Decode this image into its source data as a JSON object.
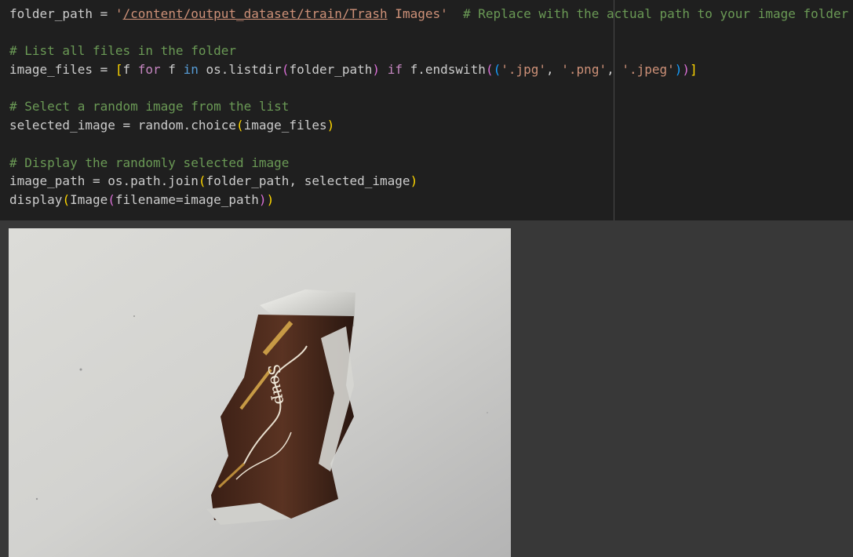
{
  "code": {
    "l1": {
      "var": "folder_path",
      "eq": " = ",
      "q_open": "'",
      "path_link": "/content/output_dataset/train/Trash",
      "path_rest": " Images",
      "q_close": "'",
      "comment": "  # Replace with the actual path to your image folder"
    },
    "l2": {
      "comment": "# List all files in the folder"
    },
    "l3": {
      "a": "image_files = ",
      "br_open": "[",
      "f1": "f ",
      "for_kw": "for",
      "f2": " f ",
      "in_kw": "in",
      "call": " os.listdir",
      "p_open": "(",
      "arg": "folder_path",
      "p_close": ")",
      "sp1": " ",
      "if_kw": "if",
      "method": " f.endswith",
      "pp_open": "(",
      "t_open": "(",
      "ext1": "'.jpg'",
      "c1": ", ",
      "ext2": "'.png'",
      "c2": ", ",
      "ext3": "'.jpeg'",
      "t_close": ")",
      "pp_close": ")",
      "br_close": "]"
    },
    "l4": {
      "comment": "# Select a random image from the list"
    },
    "l5": {
      "a": "selected_image = random.choice",
      "p_open": "(",
      "arg": "image_files",
      "p_close": ")"
    },
    "l6": {
      "comment": "# Display the randomly selected image"
    },
    "l7": {
      "a": "image_path = os.path.join",
      "p_open": "(",
      "arg": "folder_path, selected_image",
      "p_close": ")"
    },
    "l8": {
      "a": "display",
      "p_open": "(",
      "b": "Image",
      "pp_open": "(",
      "arg": "filename=image_path",
      "pp_close": ")",
      "p_close": ")"
    }
  },
  "output": {
    "image_label": "Soup"
  },
  "colors": {
    "editor_bg": "#1f1f1f",
    "output_bg": "#383838",
    "comment": "#6a9955",
    "string": "#ce9178",
    "keyword": "#569cd6",
    "control": "#c586c0",
    "bracket_1": "#ffd700",
    "bracket_2": "#da70d6",
    "bracket_3": "#179fff"
  }
}
